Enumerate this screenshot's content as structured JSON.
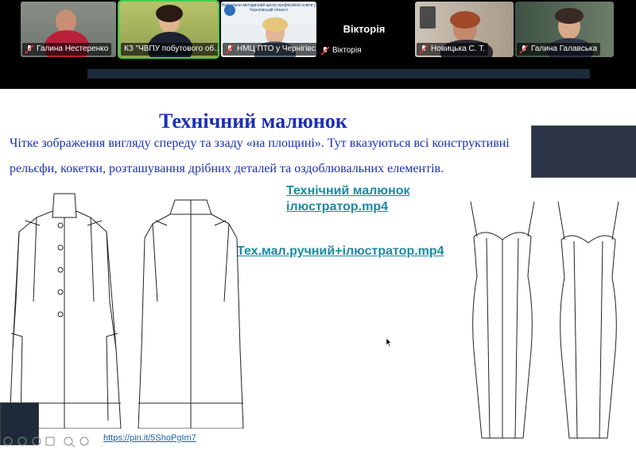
{
  "participants": [
    {
      "name": "Галина Нестеренко",
      "muted": true
    },
    {
      "name": "КЗ \"ЧВПУ побутового об...",
      "muted": false,
      "active": true
    },
    {
      "name": "НМЦ ПТО у Чернігівс...",
      "muted": true
    },
    {
      "name": "Вікторія",
      "muted": true
    },
    {
      "name": "Новицька С. Т.",
      "muted": true
    },
    {
      "name": "Галина Галавська",
      "muted": true
    }
  ],
  "center_label": "Вікторія",
  "banner_text": "Навчально-методичний центр професійної освіти у Чернігівській області",
  "slide": {
    "title": "Технічний малюнок",
    "paragraph_line1": "Чітке зображення вигляду спереду та ззаду «на площині». Тут вказуються всі конструктивні",
    "paragraph_line2": "рельєфи, кокетки, розташування дрібних деталей та оздоблювальних елементів.",
    "link1_line1": "Технічний малюнок",
    "link1_line2": "ілюстратор.mp4",
    "link2": "Тех.мал.ручний+ілюстратор.mp4",
    "source_link": "https://pin.it/5ShoPgIm7"
  },
  "icons": {
    "mic": "mic-muted-icon",
    "zoom": "zoom-icon",
    "cursor": "cursor-arrow-icon"
  },
  "colors": {
    "title": "#1a2fb5",
    "link": "#1a8aa6",
    "active_border": "#3fd04f"
  }
}
